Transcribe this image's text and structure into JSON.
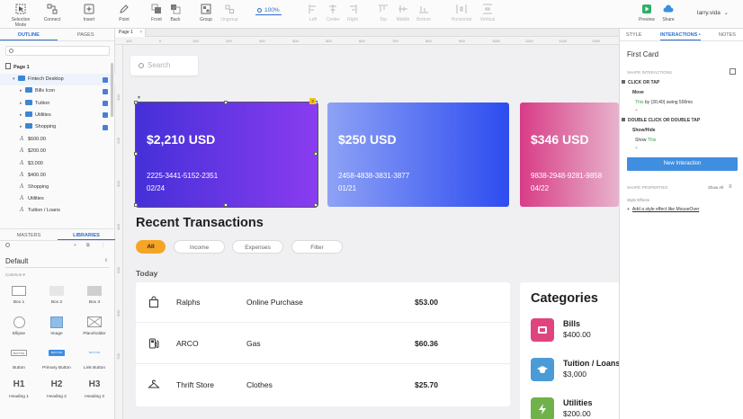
{
  "toolbar": {
    "selection_mode": "Selection Mode",
    "connect": "Connect",
    "insert": "Insert",
    "point": "Point",
    "front": "Front",
    "back": "Back",
    "group": "Group",
    "ungroup": "Ungroup",
    "zoom": "100%",
    "left": "Left",
    "center": "Center",
    "right": "Right",
    "top": "Top",
    "middle": "Middle",
    "bottom": "Bottom",
    "horizontal": "Horizontal",
    "vertical": "Vertical",
    "preview": "Preview",
    "share": "Share",
    "user": "larry.vida"
  },
  "left_panel": {
    "tabs": [
      "OUTLINE",
      "PAGES"
    ],
    "tree": [
      {
        "label": "Page 1",
        "type": "page",
        "indent": 0
      },
      {
        "label": "Fintech Desktop",
        "type": "folder",
        "indent": 1,
        "expanded": true,
        "checked": true
      },
      {
        "label": "Bills Icon",
        "type": "folder",
        "indent": 2,
        "checked": true
      },
      {
        "label": "Tuition",
        "type": "folder",
        "indent": 2,
        "checked": true
      },
      {
        "label": "Utilities",
        "type": "folder",
        "indent": 2,
        "checked": true
      },
      {
        "label": "Shopping",
        "type": "folder",
        "indent": 2,
        "checked": true
      },
      {
        "label": "$600.00",
        "type": "text",
        "indent": 2
      },
      {
        "label": "$200.00",
        "type": "text",
        "indent": 2
      },
      {
        "label": "$3,000",
        "type": "text",
        "indent": 2
      },
      {
        "label": "$400.00",
        "type": "text",
        "indent": 2
      },
      {
        "label": "Shopping",
        "type": "text",
        "indent": 2
      },
      {
        "label": "Utilities",
        "type": "text",
        "indent": 2
      },
      {
        "label": "Tuition / Loans",
        "type": "text",
        "indent": 2
      },
      {
        "label": "Bills",
        "type": "text",
        "indent": 2
      }
    ],
    "bottom_tabs": [
      "MASTERS",
      "LIBRARIES"
    ],
    "library_select": "Default",
    "library_group": "Common ▾",
    "library_items": [
      {
        "label": "Box 1",
        "shape": "box1"
      },
      {
        "label": "Box 2",
        "shape": "box2"
      },
      {
        "label": "Box 3",
        "shape": "box3"
      },
      {
        "label": "Ellipse",
        "shape": "ellipse"
      },
      {
        "label": "Image",
        "shape": "image"
      },
      {
        "label": "Placeholder",
        "shape": "placeholder"
      },
      {
        "label": "Button",
        "shape": "button"
      },
      {
        "label": "Primary Button",
        "shape": "primary"
      },
      {
        "label": "Link Button",
        "shape": "link"
      },
      {
        "label": "Heading 1",
        "shape": "h1",
        "glyph": "H1"
      },
      {
        "label": "Heading 2",
        "shape": "h2",
        "glyph": "H2"
      },
      {
        "label": "Heading 3",
        "shape": "h3",
        "glyph": "H3"
      }
    ],
    "button_caption": "BUTTON"
  },
  "page_tab": {
    "label": "Page 1",
    "close": "×"
  },
  "rulers": {
    "h": [
      "100",
      "0",
      "100",
      "200",
      "300",
      "400",
      "500",
      "600",
      "700",
      "800",
      "900",
      "1000",
      "1100",
      "1200",
      "1300"
    ],
    "v": [
      "100",
      "200",
      "300",
      "400",
      "500",
      "600",
      "700"
    ]
  },
  "canvas": {
    "search_placeholder": "Search",
    "cards": [
      {
        "amount": "$2,210 USD",
        "number": "2225-3441-5152-2351",
        "expiry": "02/24",
        "color_a": "#4530d8",
        "color_b": "#8a3cf0"
      },
      {
        "amount": "$250 USD",
        "number": "2458-4838-3831-3877",
        "expiry": "01/21",
        "color_a": "#8ea2f5",
        "color_b": "#2d4cf0"
      },
      {
        "amount": "$346 USD",
        "number": "9838-2948-9281-9858",
        "expiry": "04/22",
        "color_a": "#d83c86",
        "color_b": "#e7b3cc"
      }
    ],
    "recent_title": "Recent Transactions",
    "filters": [
      "All",
      "Income",
      "Expenses",
      "Filter"
    ],
    "today": "Today",
    "transactions": [
      {
        "icon": "bag-icon",
        "merchant": "Ralphs",
        "category": "Online Purchase",
        "amount": "$53.00"
      },
      {
        "icon": "gas-icon",
        "merchant": "ARCO",
        "category": "Gas",
        "amount": "$60.36"
      },
      {
        "icon": "hanger-icon",
        "merchant": "Thrift Store",
        "category": "Clothes",
        "amount": "$25.70"
      }
    ],
    "categories_title": "Categories",
    "categories": [
      {
        "name": "Bills",
        "amount": "$400.00",
        "color": "#e0447f",
        "icon": "bills-icon"
      },
      {
        "name": "Tuition / Loans",
        "amount": "$3,000",
        "color": "#4a9bd6",
        "icon": "graduation-cap-icon"
      },
      {
        "name": "Utilities",
        "amount": "$200.00",
        "color": "#6fb24a",
        "icon": "lightning-icon"
      }
    ],
    "selection_badge": "3"
  },
  "right_panel": {
    "tabs": [
      "STYLE",
      "INTERACTIONS",
      "NOTES"
    ],
    "active_tab_suffix": "•",
    "title": "First Card",
    "shape_interactions": "SHAPE INTERACTIONS",
    "click_or_tap": "CLICK OR TAP",
    "move": "Move",
    "move_this": "This",
    "move_detail": " by (30,40) swing 500ms",
    "plus": "+",
    "double_click": "DOUBLE CLICK OR DOUBLE TAP",
    "show_hide": "Show/Hide",
    "show_this_pre": "Show ",
    "show_this": "This",
    "new_interaction": "New Interaction",
    "shape_properties": "SHAPE PROPERTIES",
    "show_all": "Show All",
    "style_effects": "Style Effects",
    "add_style": "Add a style effect like MouseOver"
  },
  "colors": {
    "accent": "#2a6fd0",
    "filter_active": "#f5a524",
    "new_interaction": "#3f8ee0"
  }
}
